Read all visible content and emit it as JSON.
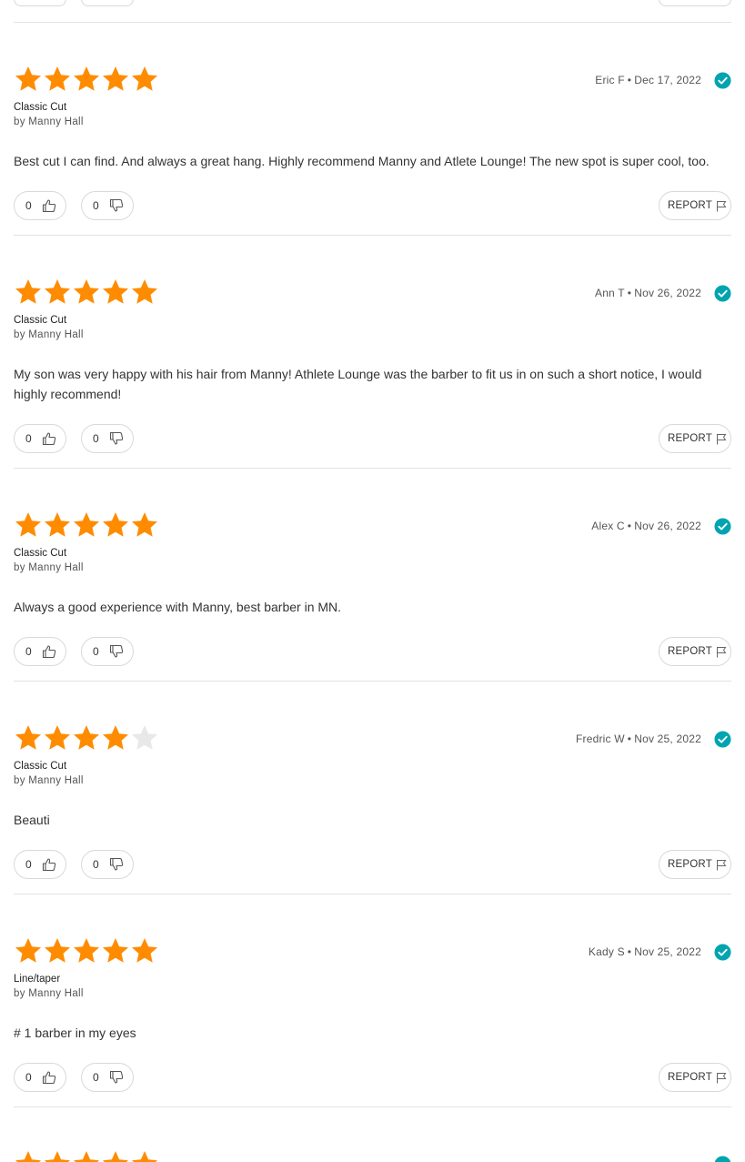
{
  "colors": {
    "star_filled": "#ff8c00",
    "star_empty": "#e8e8e8",
    "verified": "#00a4b0"
  },
  "reviews": [
    {
      "rating": 5,
      "author": "Eric F",
      "date": "Dec 17, 2022",
      "service": "Classic Cut",
      "by": "by Manny Hall",
      "text": "Best cut I can find. And always a great hang. Highly recommend Manny and Atlete Lounge! The new spot is super cool, too.",
      "likes": "0",
      "dislikes": "0",
      "report_label": "REPORT"
    },
    {
      "rating": 5,
      "author": "Ann T",
      "date": "Nov 26, 2022",
      "service": "Classic Cut",
      "by": "by Manny Hall",
      "text": "My son was very happy with his hair from Manny! Athlete Lounge was the barber to fit us in on such a short notice, I would highly recommend!",
      "likes": "0",
      "dislikes": "0",
      "report_label": "REPORT"
    },
    {
      "rating": 5,
      "author": "Alex C",
      "date": "Nov 26, 2022",
      "service": "Classic Cut",
      "by": "by Manny Hall",
      "text": "Always a good experience with Manny, best barber in MN.",
      "likes": "0",
      "dislikes": "0",
      "report_label": "REPORT"
    },
    {
      "rating": 4,
      "author": "Fredric W",
      "date": "Nov 25, 2022",
      "service": "Classic Cut",
      "by": "by Manny Hall",
      "text": "Beauti",
      "likes": "0",
      "dislikes": "0",
      "report_label": "REPORT"
    },
    {
      "rating": 5,
      "author": "Kady S",
      "date": "Nov 25, 2022",
      "service": "Line/taper",
      "by": "by Manny Hall",
      "text": "# 1 barber in my eyes",
      "likes": "0",
      "dislikes": "0",
      "report_label": "REPORT"
    }
  ]
}
